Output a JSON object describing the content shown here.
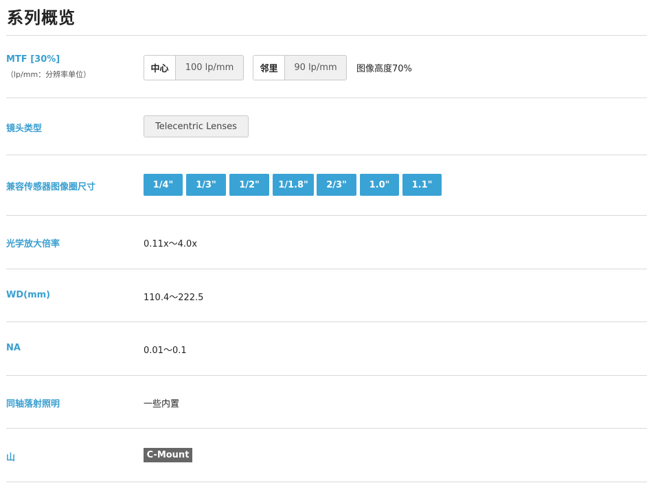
{
  "title": "系列概览",
  "mtf": {
    "label": "MTF [30%]",
    "sublabel": "（lp/mm：分辨率单位）",
    "center_key": "中心",
    "center_value": "100 lp/mm",
    "near_key": "邻里",
    "near_value": "90 lp/mm",
    "note": "图像高度70%"
  },
  "lens_type": {
    "label": "镜头类型",
    "value": "Telecentric Lenses"
  },
  "sensor_size": {
    "label": "兼容传感器图像圈尺寸",
    "sizes": [
      "1/4\"",
      "1/3\"",
      "1/2\"",
      "1/1.8\"",
      "2/3\"",
      "1.0\"",
      "1.1\""
    ],
    "chip_color": "#3aa3d5"
  },
  "magnification": {
    "label": "光学放大倍率",
    "value": "0.11x～4.0x"
  },
  "wd": {
    "label": "WD(mm)",
    "value": "110.4～222.5"
  },
  "na": {
    "label": "NA",
    "value": "0.01～0.1"
  },
  "coaxial": {
    "label": "同轴落射照明",
    "value": "一些内置"
  },
  "mount": {
    "label": "山",
    "value": "C-Mount"
  },
  "colors": {
    "accent": "#3a9fd0",
    "mount_bg": "#666666"
  }
}
